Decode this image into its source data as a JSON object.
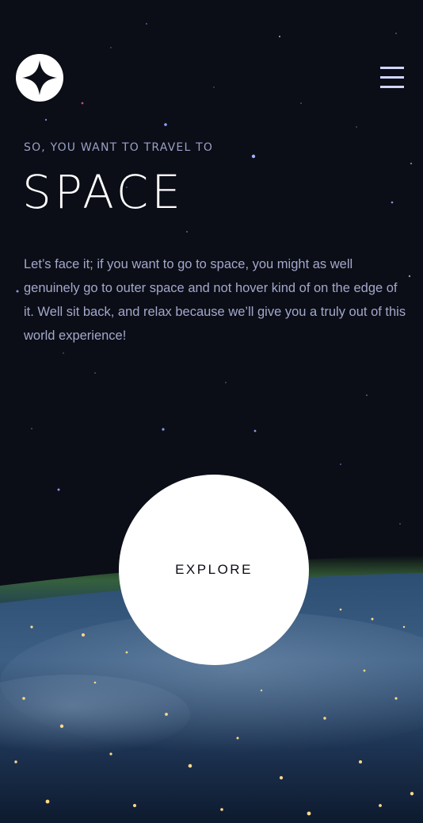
{
  "header": {
    "logo_icon": "star-logo-icon",
    "menu_icon": "hamburger-menu-icon"
  },
  "hero": {
    "kicker": "SO, YOU WANT TO TRAVEL TO",
    "title": "SPACE",
    "description": "Let’s face it; if you want to go to space, you might as well genuinely go to outer space and not hover kind of on the edge of it. Well sit back, and relax because we’ll give you a truly out of this world experience!"
  },
  "cta": {
    "label": "EXPLORE"
  },
  "colors": {
    "background": "#0b0d17",
    "accent": "#d0d6f9",
    "text_muted": "#a3a8c9",
    "white": "#ffffff"
  }
}
